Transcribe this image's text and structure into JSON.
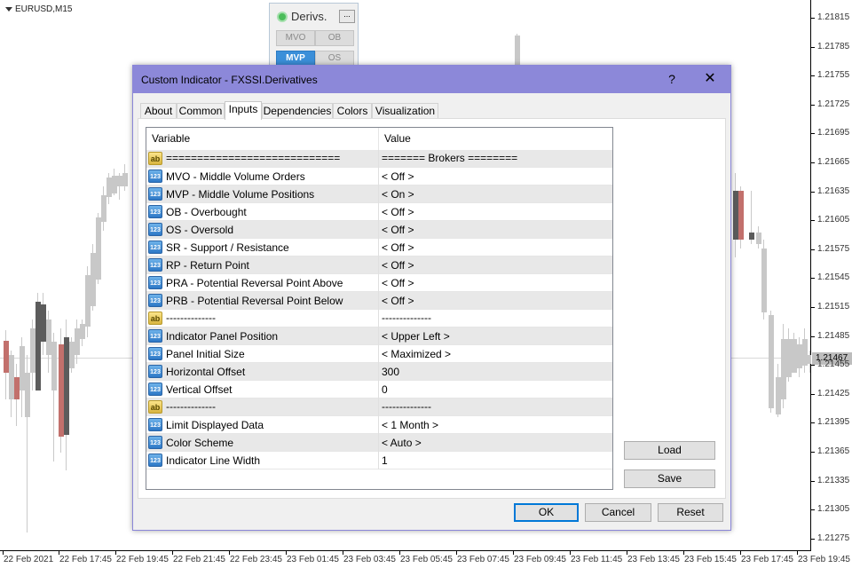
{
  "chart": {
    "symbol": "EURUSD,M15",
    "current_price": "1.21467",
    "price_labels": [
      "1.21815",
      "1.21785",
      "1.21755",
      "1.21725",
      "1.21695",
      "1.21665",
      "1.21635",
      "1.21605",
      "1.21575",
      "1.21545",
      "1.21515",
      "1.21485",
      "1.21455",
      "1.21425",
      "1.21395",
      "1.21365",
      "1.21335",
      "1.21305",
      "1.21275"
    ],
    "time_labels": [
      "22 Feb 2021",
      "22 Feb 17:45",
      "22 Feb 19:45",
      "22 Feb 21:45",
      "22 Feb 23:45",
      "23 Feb 01:45",
      "23 Feb 03:45",
      "23 Feb 05:45",
      "23 Feb 07:45",
      "23 Feb 09:45",
      "23 Feb 11:45",
      "23 Feb 13:45",
      "23 Feb 15:45",
      "23 Feb 17:45",
      "23 Feb 19:45"
    ],
    "colors": {
      "bull": "#c8c8c8",
      "bear_dark": "#5c5c5c",
      "bear_red": "#c2706c"
    }
  },
  "panel": {
    "title": "Derivs.",
    "minimize": "...",
    "buttons": [
      {
        "label": "MVO",
        "active": false
      },
      {
        "label": "OB",
        "active": false
      },
      {
        "label": "MVP",
        "active": true
      },
      {
        "label": "OS",
        "active": false
      }
    ]
  },
  "dialog": {
    "title": "Custom Indicator - FXSSI.Derivatives",
    "help": "?",
    "close": "✕",
    "tabs": [
      "About",
      "Common",
      "Inputs",
      "Dependencies",
      "Colors",
      "Visualization"
    ],
    "active_tab": "Inputs",
    "grid": {
      "headers": {
        "variable": "Variable",
        "value": "Value"
      },
      "rows": [
        {
          "type": "ab",
          "variable": "============================",
          "value": "======= Brokers ========"
        },
        {
          "type": "num",
          "variable": "MVO - Middle Volume Orders",
          "value": "< Off >"
        },
        {
          "type": "num",
          "variable": "MVP - Middle Volume Positions",
          "value": "< On >"
        },
        {
          "type": "num",
          "variable": "OB - Overbought",
          "value": "< Off >"
        },
        {
          "type": "num",
          "variable": "OS - Oversold",
          "value": "< Off >"
        },
        {
          "type": "num",
          "variable": "SR - Support / Resistance",
          "value": "< Off >"
        },
        {
          "type": "num",
          "variable": "RP - Return Point",
          "value": "< Off >"
        },
        {
          "type": "num",
          "variable": "PRA - Potential Reversal Point Above",
          "value": "< Off >"
        },
        {
          "type": "num",
          "variable": "PRB - Potential Reversal Point Below",
          "value": "< Off >"
        },
        {
          "type": "ab",
          "variable": "--------------",
          "value": "--------------"
        },
        {
          "type": "num",
          "variable": "Indicator Panel Position",
          "value": "< Upper Left >"
        },
        {
          "type": "num",
          "variable": "Panel Initial Size",
          "value": "< Maximized >"
        },
        {
          "type": "num",
          "variable": "Horizontal Offset",
          "value": "300"
        },
        {
          "type": "num",
          "variable": "Vertical Offset",
          "value": "0"
        },
        {
          "type": "ab",
          "variable": "--------------",
          "value": "--------------"
        },
        {
          "type": "num",
          "variable": "Limit Displayed Data",
          "value": "< 1 Month >"
        },
        {
          "type": "num",
          "variable": "Color Scheme",
          "value": "< Auto >"
        },
        {
          "type": "num",
          "variable": "Indicator Line Width",
          "value": "1"
        }
      ]
    },
    "buttons": {
      "load": "Load",
      "save": "Save",
      "ok": "OK",
      "cancel": "Cancel",
      "reset": "Reset"
    }
  }
}
